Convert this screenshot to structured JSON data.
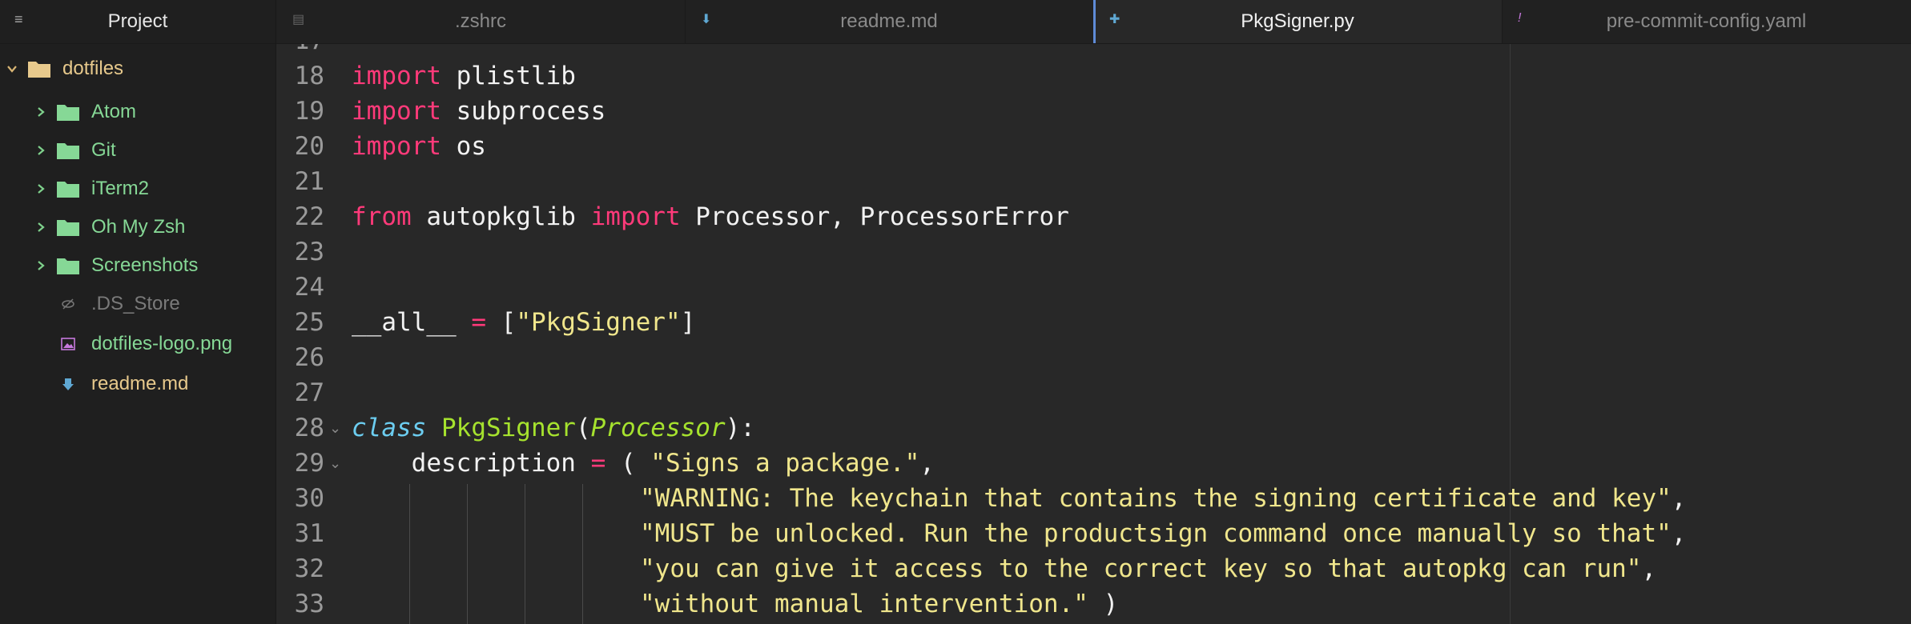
{
  "sidebar": {
    "title": "Project",
    "root": "dotfiles",
    "items": [
      {
        "label": "Atom",
        "type": "folder"
      },
      {
        "label": "Git",
        "type": "folder"
      },
      {
        "label": "iTerm2",
        "type": "folder"
      },
      {
        "label": "Oh My Zsh",
        "type": "folder"
      },
      {
        "label": "Screenshots",
        "type": "folder"
      },
      {
        "label": ".DS_Store",
        "type": "hidden-file"
      },
      {
        "label": "dotfiles-logo.png",
        "type": "image-file"
      },
      {
        "label": "readme.md",
        "type": "markdown-file"
      }
    ]
  },
  "tabs": [
    {
      "label": ".zshrc",
      "icon": "file-icon"
    },
    {
      "label": "readme.md",
      "icon": "markdown-icon"
    },
    {
      "label": "PkgSigner.py",
      "icon": "python-icon",
      "active": true
    },
    {
      "label": "pre-commit-config.yaml",
      "icon": "yaml-icon"
    }
  ],
  "editor": {
    "line_numbers": [
      "18",
      "19",
      "20",
      "21",
      "22",
      "23",
      "24",
      "25",
      "26",
      "27",
      "28",
      "29",
      "30",
      "31",
      "32",
      "33"
    ],
    "lines": {
      "l18": {
        "kw": "import",
        "rest": " plistlib"
      },
      "l19": {
        "kw": "import",
        "rest": " subprocess"
      },
      "l20": {
        "kw": "import",
        "rest": " os"
      },
      "l22": {
        "kw1": "from",
        "mid": " autopkglib ",
        "kw2": "import",
        "rest": " Processor, ProcessorError"
      },
      "l25": {
        "name": "__all__ ",
        "op": "=",
        "pre": " [",
        "str": "\"PkgSigner\"",
        "post": "]"
      },
      "l28": {
        "kw": "class",
        "name": " PkgSigner",
        "open": "(",
        "base": "Processor",
        "close": "):"
      },
      "l29": {
        "name": "    description ",
        "op": "=",
        "mid": " ( ",
        "str": "\"Signs a package.\"",
        "post": ","
      },
      "l30": {
        "str": "\"WARNING: The keychain that contains the signing certificate and key\"",
        "post": ","
      },
      "l31": {
        "str": "\"MUST be unlocked. Run the productsign command once manually so that\"",
        "post": ","
      },
      "l32": {
        "str": "\"you can give it access to the correct key so that autopkg can run\"",
        "post": ","
      },
      "l33": {
        "str": "\"without manual intervention.\"",
        "post": " )"
      }
    },
    "colors": {
      "keyword": "#ff3a7a",
      "string": "#f0e68c",
      "class_keyword": "#6ccdf0",
      "class_name": "#a6e22e"
    }
  }
}
